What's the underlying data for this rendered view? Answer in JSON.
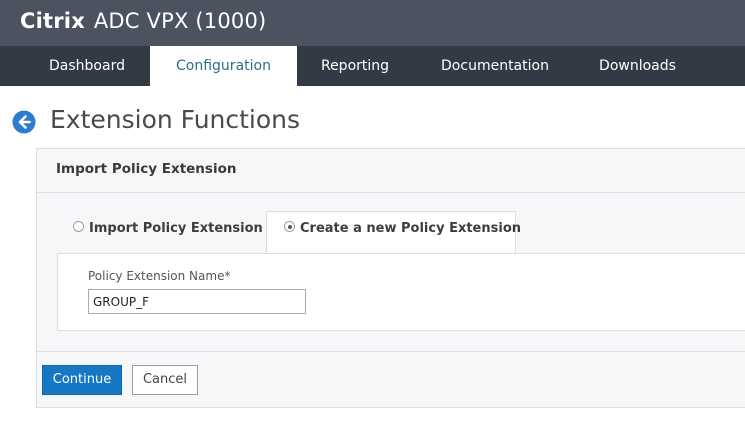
{
  "app": {
    "brand": "Citrix",
    "product": "ADC VPX (1000)"
  },
  "nav": {
    "tabs": [
      {
        "label": "Dashboard"
      },
      {
        "label": "Configuration"
      },
      {
        "label": "Reporting"
      },
      {
        "label": "Documentation"
      },
      {
        "label": "Downloads"
      }
    ],
    "active": "Configuration"
  },
  "page": {
    "title": "Extension Functions",
    "back_icon": "arrow-left-circle-icon"
  },
  "panel": {
    "title": "Import Policy Extension",
    "options": [
      {
        "label": "Import Policy Extension",
        "selected": false
      },
      {
        "label": "Create a new Policy Extension",
        "selected": true
      }
    ],
    "field": {
      "label": "Policy Extension Name*",
      "value": "GROUP_F"
    },
    "buttons": {
      "continue": "Continue",
      "cancel": "Cancel"
    }
  },
  "colors": {
    "header_bg": "#4b5361",
    "nav_bg": "#333a45",
    "active_tab_text": "#2a6f86",
    "primary_button": "#1677c4"
  }
}
